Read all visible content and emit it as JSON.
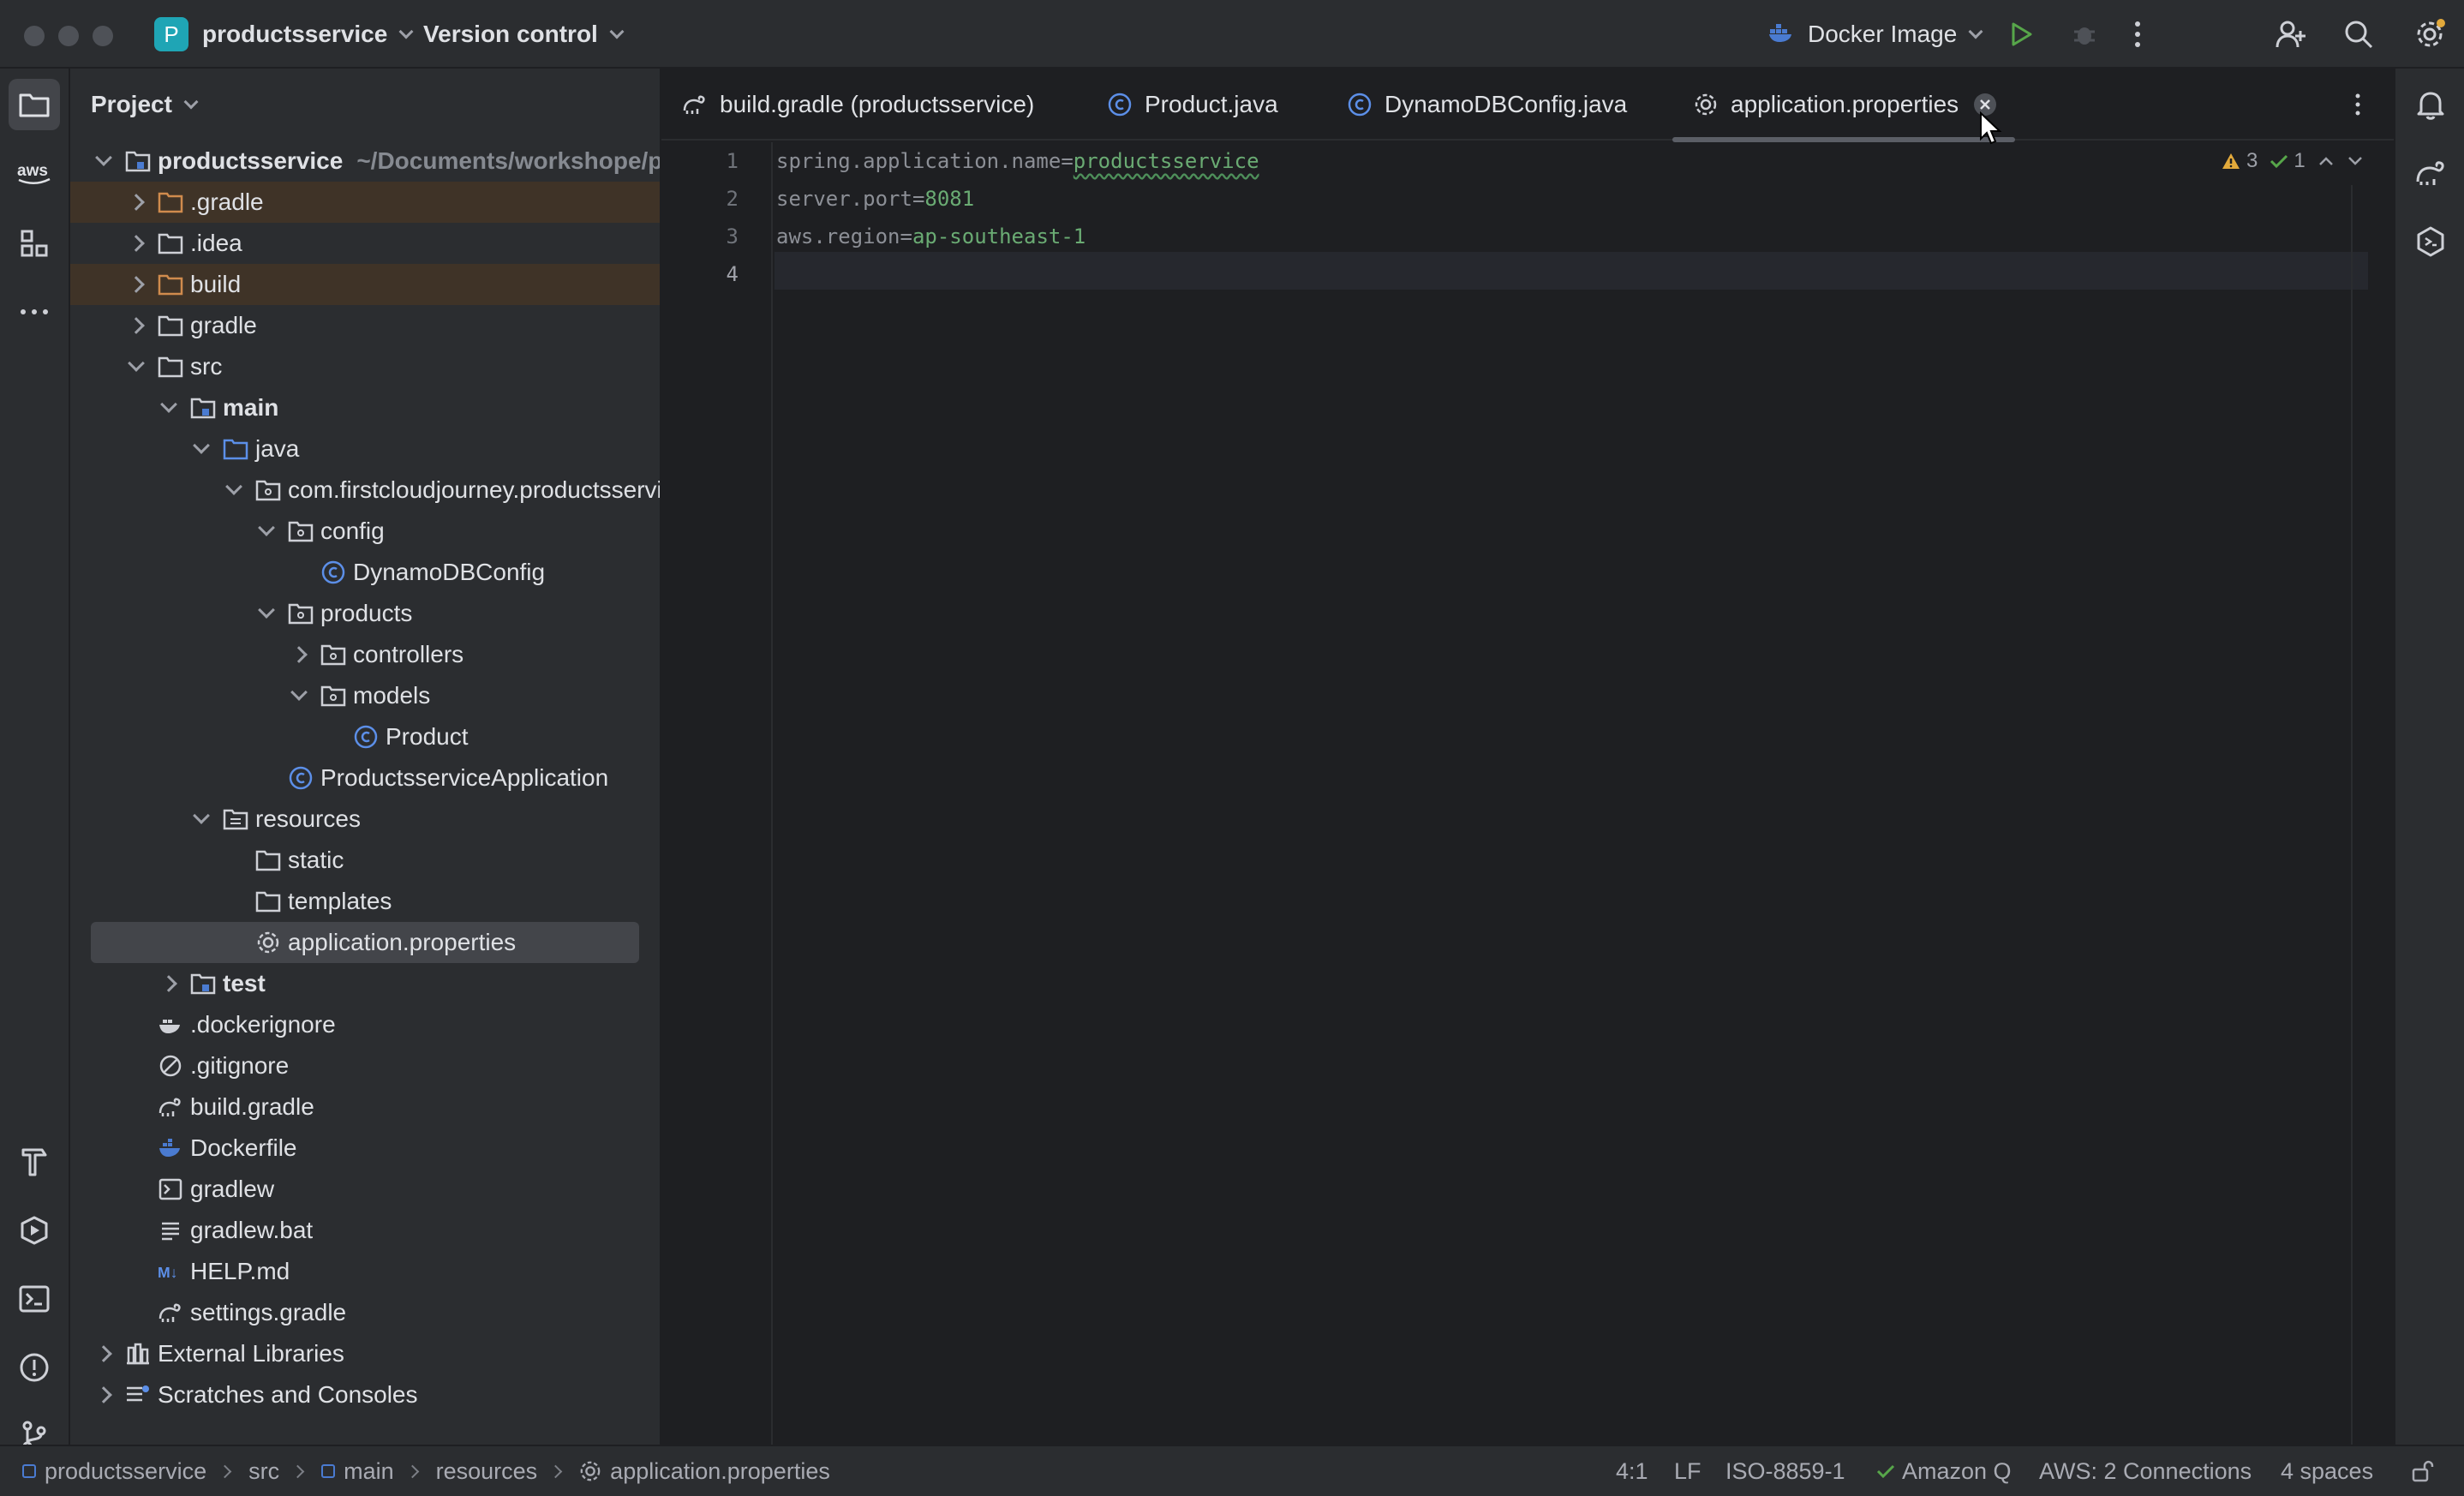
{
  "titlebar": {
    "project_badge": "P",
    "project_name": "productsservice",
    "vcs_label": "Version control",
    "run_config": "Docker Image"
  },
  "sidebar": {
    "tools": [
      "folder-icon",
      "aws-icon",
      "structure-icon",
      "more-icon",
      "build-hammer-icon",
      "services-icon",
      "terminal-icon",
      "problems-icon",
      "git-icon"
    ]
  },
  "project_panel": {
    "title": "Project",
    "root_name": "productsservice",
    "root_path": "~/Documents/workshope/productsservice",
    "items": [
      {
        "label": ".gradle"
      },
      {
        "label": ".idea"
      },
      {
        "label": "build"
      },
      {
        "label": "gradle"
      },
      {
        "label": "src"
      },
      {
        "label": "main"
      },
      {
        "label": "java"
      },
      {
        "label": "com.firstcloudjourney.productsservice"
      },
      {
        "label": "config"
      },
      {
        "label": "DynamoDBConfig"
      },
      {
        "label": "products"
      },
      {
        "label": "controllers"
      },
      {
        "label": "models"
      },
      {
        "label": "Product"
      },
      {
        "label": "ProductsserviceApplication"
      },
      {
        "label": "resources"
      },
      {
        "label": "static"
      },
      {
        "label": "templates"
      },
      {
        "label": "application.properties"
      },
      {
        "label": "test"
      },
      {
        "label": ".dockerignore"
      },
      {
        "label": ".gitignore"
      },
      {
        "label": "build.gradle"
      },
      {
        "label": "Dockerfile"
      },
      {
        "label": "gradlew"
      },
      {
        "label": "gradlew.bat"
      },
      {
        "label": "HELP.md"
      },
      {
        "label": "settings.gradle"
      },
      {
        "label": "External Libraries"
      },
      {
        "label": "Scratches and Consoles"
      }
    ]
  },
  "tabs": [
    {
      "label": "build.gradle (productsservice)"
    },
    {
      "label": "Product.java"
    },
    {
      "label": "DynamoDBConfig.java"
    },
    {
      "label": "application.properties"
    }
  ],
  "editor": {
    "line_numbers": [
      "1",
      "2",
      "3",
      "4"
    ],
    "lines": [
      {
        "key": "spring.application.name=",
        "value": "productsservice"
      },
      {
        "key": "server.port=",
        "value": "8081"
      },
      {
        "key": "aws.region=",
        "value": "ap-southeast-1"
      }
    ],
    "warnings": "3",
    "ok_count": "1"
  },
  "statusbar": {
    "breadcrumb": [
      "productsservice",
      "src",
      "main",
      "resources",
      "application.properties"
    ],
    "position": "4:1",
    "line_sep": "LF",
    "encoding": "ISO-8859-1",
    "amazon_q": "Amazon Q",
    "aws": "AWS: 2 Connections",
    "indent": "4 spaces"
  },
  "colors": {
    "accent_green": "#6aab73",
    "excluded_bg": "#3f3327",
    "badge": "#1fa5b5",
    "warning": "#e2a93b"
  }
}
